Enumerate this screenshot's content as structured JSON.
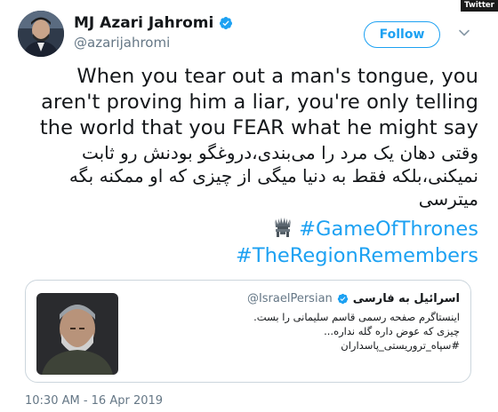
{
  "badge": "Twitter",
  "author": {
    "display_name": "MJ Azari Jahromi",
    "handle": "@azarijahromi",
    "verified_icon": "verified-badge-icon"
  },
  "follow_label": "Follow",
  "menu_icon": "chevron-down-icon",
  "tweet": {
    "english_lines": [
      "When you tear out a man's tongue, you",
      "aren't proving him a liar, you're only telling",
      "the world that you FEAR what he might say"
    ],
    "persian_lines": [
      "وقتی دهان یک مرد را می‌بندی،دروغگو بودنش رو ثابت",
      "نمیکنی،بلکه فقط به دنیا میگی از چیزی که او ممکنه بگه",
      "میترسی"
    ],
    "hashtags": [
      "#GameOfThrones",
      "#TheRegionRemembers"
    ],
    "hashtag_icon": "iron-throne-icon"
  },
  "quoted": {
    "display_name": "اسرائیل به فارسی",
    "handle": "@IsraelPersian",
    "lines": [
      "اینستاگرم صفحه رسمی قاسم سلیمانی را بست.",
      "چیزی که عوض داره گله نداره...",
      "#سپاه_تروریستی_پاسداران"
    ]
  },
  "timestamp": "10:30 AM - 16 Apr 2019",
  "colors": {
    "accent": "#1da1f2",
    "text": "#14171a",
    "secondary": "#657786",
    "border": "#ccd6dd"
  }
}
